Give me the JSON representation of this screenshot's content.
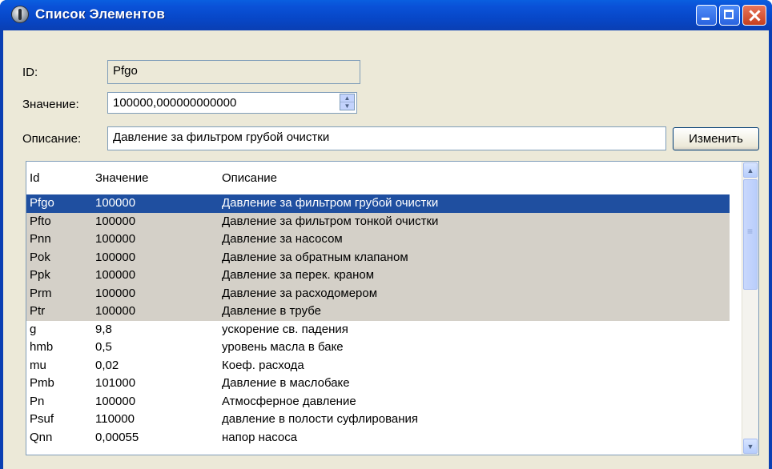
{
  "window": {
    "title": "Список Элементов"
  },
  "form": {
    "id_label": "ID:",
    "id_value": "Pfgo",
    "value_label": "Значение:",
    "value_value": "100000,000000000000",
    "desc_label": "Описание:",
    "desc_value": "Давление за фильтром грубой очистки",
    "change_button": "Изменить"
  },
  "table": {
    "columns": [
      "Id",
      "Значение",
      "Описание"
    ],
    "rows": [
      {
        "id": "Pfgo",
        "value": "100000",
        "desc": "Давление за фильтром грубой очистки"
      },
      {
        "id": "Pfto",
        "value": "100000",
        "desc": "Давление за фильтром тонкой очистки"
      },
      {
        "id": "Pnn",
        "value": "100000",
        "desc": "Давление за насосом"
      },
      {
        "id": "Pok",
        "value": "100000",
        "desc": "Давление за обратным клапаном"
      },
      {
        "id": "Ppk",
        "value": "100000",
        "desc": "Давление за перек. краном"
      },
      {
        "id": "Prm",
        "value": "100000",
        "desc": "Давление за расходомером"
      },
      {
        "id": "Ptr",
        "value": "100000",
        "desc": "Давление в трубе"
      },
      {
        "id": "g",
        "value": "9,8",
        "desc": "ускорение св. падения"
      },
      {
        "id": "hmb",
        "value": "0,5",
        "desc": "уровень масла в баке"
      },
      {
        "id": "mu",
        "value": "0,02",
        "desc": "Коеф. расхода"
      },
      {
        "id": "Pmb",
        "value": "101000",
        "desc": "Давление в маслобаке"
      },
      {
        "id": "Pn",
        "value": "100000",
        "desc": "Атмосферное давление"
      },
      {
        "id": "Psuf",
        "value": "110000",
        "desc": "давление в полости суфлирования"
      },
      {
        "id": "Qnn",
        "value": "0,00055",
        "desc": "напор насоса"
      }
    ],
    "selected_index": 0,
    "highlighted_count": 7
  }
}
